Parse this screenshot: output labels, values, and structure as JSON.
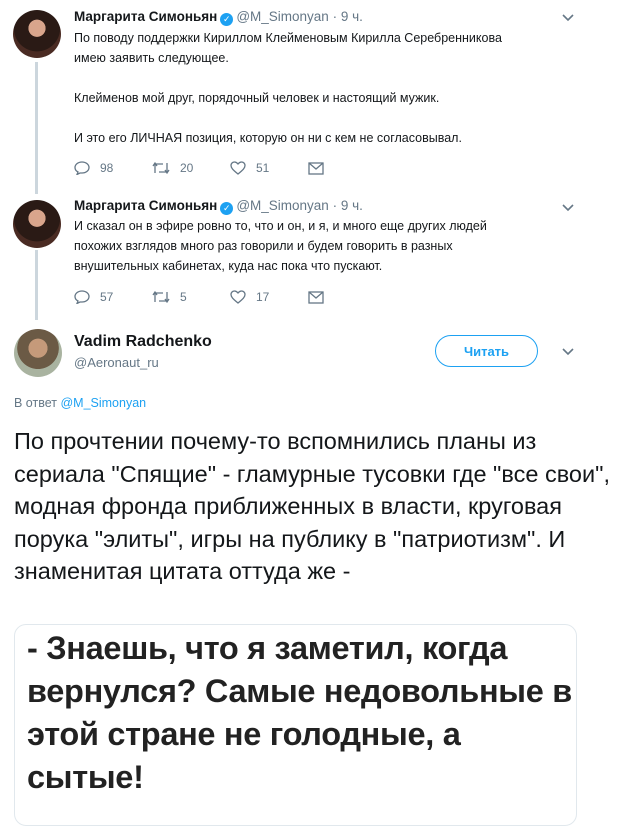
{
  "tweets": [
    {
      "name": "Маргарита Симоньян",
      "handle": "@M_Simonyan",
      "time": "· 9 ч.",
      "lines": [
        "По поводу поддержки Кириллом Клейменовым Кирилла Серебренникова",
        "имею заявить следующее.",
        "",
        "Клейменов мой друг, порядочный человек и настоящий мужик.",
        "",
        "И это его ЛИЧНАЯ позиция, которую он ни с кем не согласовывал."
      ],
      "replies": "98",
      "retweets": "20",
      "likes": "51"
    },
    {
      "name": "Маргарита Симоньян",
      "handle": "@M_Simonyan",
      "time": "· 9 ч.",
      "lines": [
        "И сказал он в эфире ровно то, что и он, и я, и много еще других людей",
        "похожих взглядов много раз говорили и будем говорить в разных",
        "внушительных кабинетах, куда нас пока что пускают."
      ],
      "replies": "57",
      "retweets": "5",
      "likes": "17"
    }
  ],
  "main": {
    "name": "Vadim Radchenko",
    "handle": "@Aeronaut_ru",
    "follow_label": "Читать",
    "reply_prefix": "В ответ",
    "reply_handle": "@M_Simonyan",
    "text": "По прочтении почему-то вспомнились планы из сериала \"Спящие\" - гламурные тусовки где \"все свои\", модная фронда приближенных в власти, круговая порука \"элиты\", игры на публику в \"патриотизм\". И знаменитая цитата оттуда же -",
    "media_text": "- Знаешь, что я заметил, когда вернулся? Самые недовольные в этой стране не голодные, а сытые!"
  },
  "colors": {
    "accent": "#1da1f2",
    "muted": "#657786",
    "text": "#14171a",
    "line": "#ccd6dd"
  },
  "icons": [
    "verified-badge-icon",
    "chevron-down-icon",
    "reply-icon",
    "retweet-icon",
    "like-icon",
    "message-icon"
  ]
}
